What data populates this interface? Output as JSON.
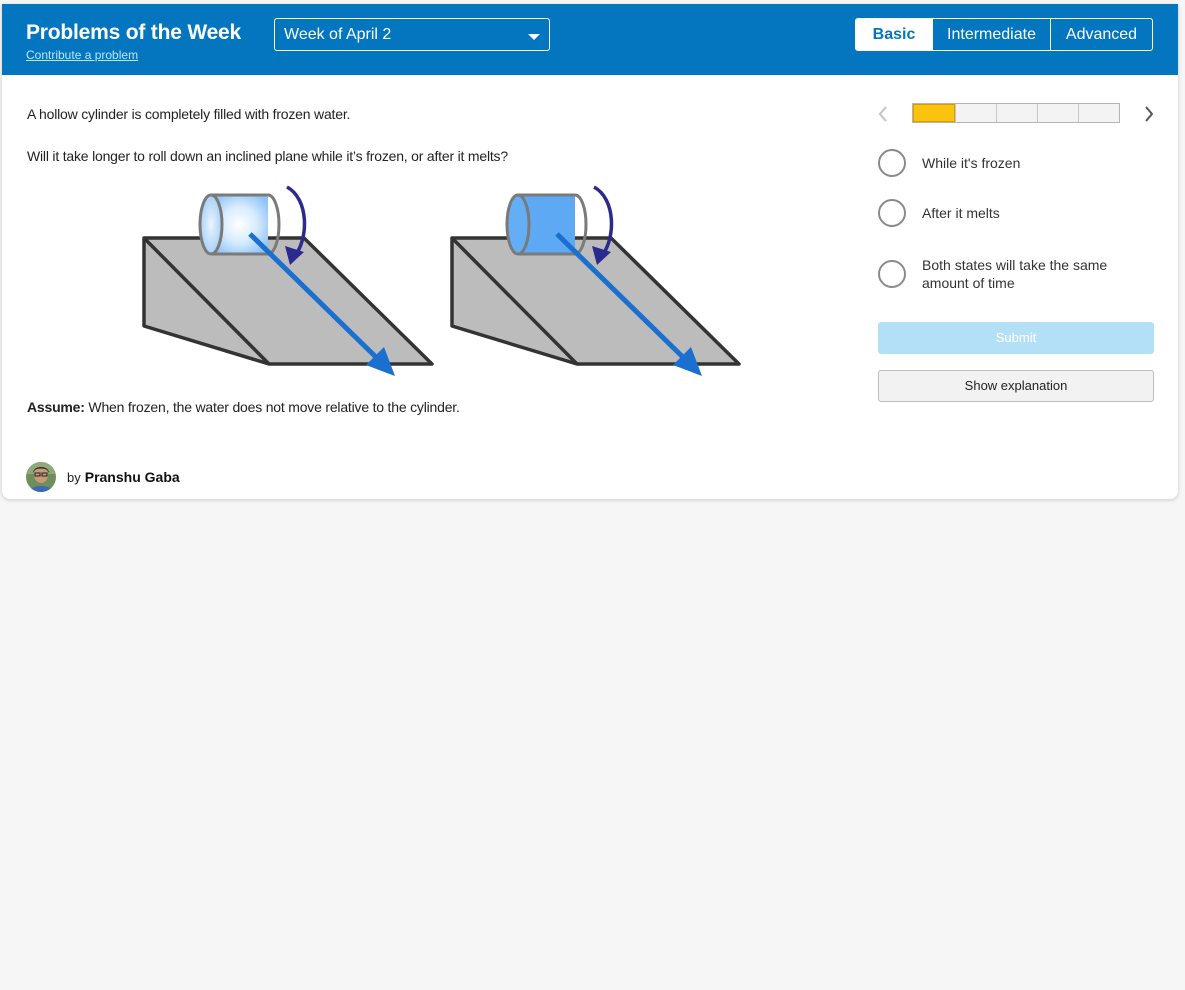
{
  "header": {
    "title": "Problems of the Week",
    "contribute_link": "Contribute a problem",
    "week_select": {
      "selected": "Week of April 2"
    },
    "levels": [
      {
        "label": "Basic",
        "active": true
      },
      {
        "label": "Intermediate",
        "active": false
      },
      {
        "label": "Advanced",
        "active": false
      }
    ]
  },
  "problem": {
    "statement": "A hollow cylinder is completely filled with frozen water.",
    "question": "Will it take longer to roll down an inclined plane while it’s frozen, or after it melts?",
    "assume_label": "Assume:",
    "assume_text": " When frozen, the water does not move relative to the cylinder.",
    "author_prefix": "by",
    "author": "Pranshu Gaba"
  },
  "progress": {
    "completed": 1,
    "total": 5
  },
  "options": [
    {
      "label": "While it's frozen"
    },
    {
      "label": "After it melts"
    },
    {
      "label": "Both states will take the same amount of time"
    }
  ],
  "actions": {
    "submit": "Submit",
    "explanation": "Show explanation"
  },
  "colors": {
    "header_bg": "#0476bf",
    "progress_fill": "#fcc30e",
    "submit_disabled": "#b4e0f7",
    "arrow_blue": "#1a6fcf",
    "rotation_arrow": "#2b2a8f",
    "frozen_cylinder": "#d9ecfd",
    "melted_cylinder": "#5ea9f4",
    "ramp_gray": "#bcbcbc"
  },
  "icons": [
    "chevron-down-icon",
    "chevron-left-icon",
    "chevron-right-icon",
    "radio-icon",
    "avatar-photo"
  ]
}
